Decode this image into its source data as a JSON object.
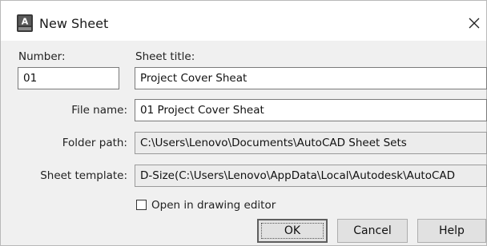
{
  "window": {
    "title": "New Sheet",
    "icon": "autocad-app-icon",
    "close_icon": "close-icon"
  },
  "form": {
    "number_label": "Number:",
    "number_value": "01",
    "sheet_title_label": "Sheet title:",
    "sheet_title_value": "Project Cover Sheat",
    "file_name_label": "File name:",
    "file_name_value": "01 Project Cover Sheat",
    "folder_path_label": "Folder path:",
    "folder_path_value": "C:\\Users\\Lenovo\\Documents\\AutoCAD Sheet Sets",
    "sheet_template_label": "Sheet template:",
    "sheet_template_value": "D-Size(C:\\Users\\Lenovo\\AppData\\Local\\Autodesk\\AutoCAD",
    "open_in_editor_label": "Open in drawing editor",
    "open_in_editor_checked": false
  },
  "buttons": {
    "ok": "OK",
    "cancel": "Cancel",
    "help": "Help"
  }
}
